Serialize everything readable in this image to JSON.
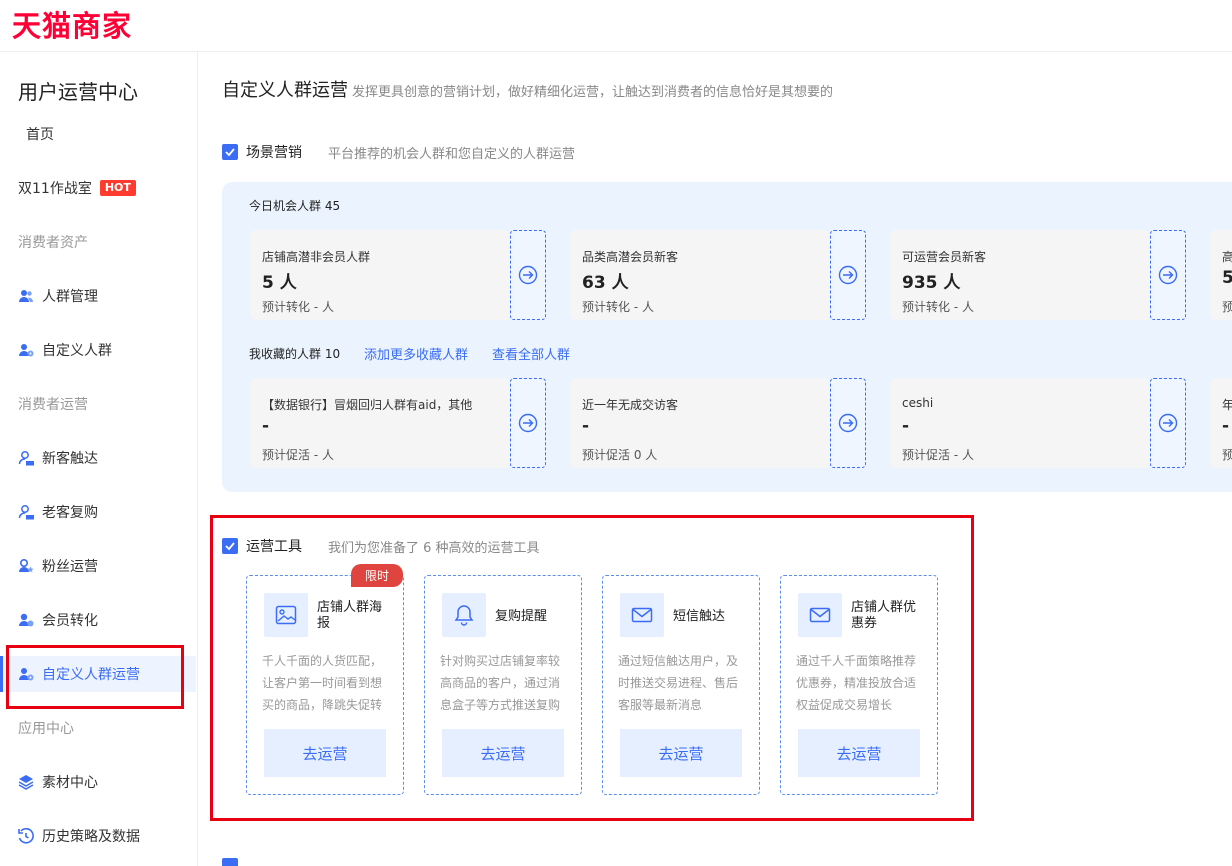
{
  "brand": {
    "logo": "天猫商家"
  },
  "sidebar": {
    "title": "用户运营中心",
    "home": "首页",
    "war_room": "双11作战室",
    "hot_badge": "HOT",
    "section_assets": "消费者资产",
    "crowd_manage": "人群管理",
    "custom_crowd": "自定义人群",
    "section_ops": "消费者运营",
    "new_reach": "新客触达",
    "old_repurchase": "老客复购",
    "fans_ops": "粉丝运营",
    "member_convert": "会员转化",
    "custom_crowd_ops": "自定义人群运营",
    "section_apps": "应用中心",
    "material_center": "素材中心",
    "history_data": "历史策略及数据"
  },
  "header": {
    "title": "自定义人群运营",
    "subtitle": "发挥更具创意的营销计划，做好精细化运营，让触达到消费者的信息恰好是其想要的"
  },
  "scene": {
    "title": "场景营销",
    "desc": "平台推荐的机会人群和您自定义的人群运营",
    "today_label": "今日机会人群 45",
    "today_cards": [
      {
        "name": "店铺高潜非会员人群",
        "value": "5 人",
        "meta": "预计转化 - 人"
      },
      {
        "name": "品类高潜会员新客",
        "value": "63 人",
        "meta": "预计转化 - 人"
      },
      {
        "name": "可运营会员新客",
        "value": "935 人",
        "meta": "预计转化 - 人"
      },
      {
        "name": "高",
        "value": "5",
        "meta": "预"
      }
    ],
    "fav_label": "我收藏的人群 10",
    "add_more": "添加更多收藏人群",
    "view_all": "查看全部人群",
    "fav_cards": [
      {
        "name": "【数据银行】冒烟回归人群有aid，其他",
        "value": "-",
        "meta": "预计促活 - 人"
      },
      {
        "name": "近一年无成交访客",
        "value": "-",
        "meta": "预计促活 0 人"
      },
      {
        "name": "ceshi",
        "value": "-",
        "meta": "预计促活 - 人"
      },
      {
        "name": "年",
        "value": "-",
        "meta": "预"
      }
    ]
  },
  "tools": {
    "title": "运营工具",
    "desc": "我们为您准备了 6 种高效的运营工具",
    "limited_badge": "限时",
    "button_label": "去运营",
    "cards": [
      {
        "name": "店铺人群海报",
        "desc": "千人千面的人货匹配，让客户第一时间看到想买的商品，降跳失促转"
      },
      {
        "name": "复购提醒",
        "desc": "针对购买过店铺复率较高商品的客户，通过消息盒子等方式推送复购"
      },
      {
        "name": "短信触达",
        "desc": "通过短信触达用户，及时推送交易进程、售后客服等最新消息"
      },
      {
        "name": "店铺人群优惠券",
        "desc": "通过千人千面策略推荐优惠券，精准投放合适权益促成交易增长"
      }
    ]
  },
  "colors": {
    "brand_red": "#ff0036",
    "accent_blue": "#3a6cf4",
    "highlight_red": "#e60012"
  }
}
